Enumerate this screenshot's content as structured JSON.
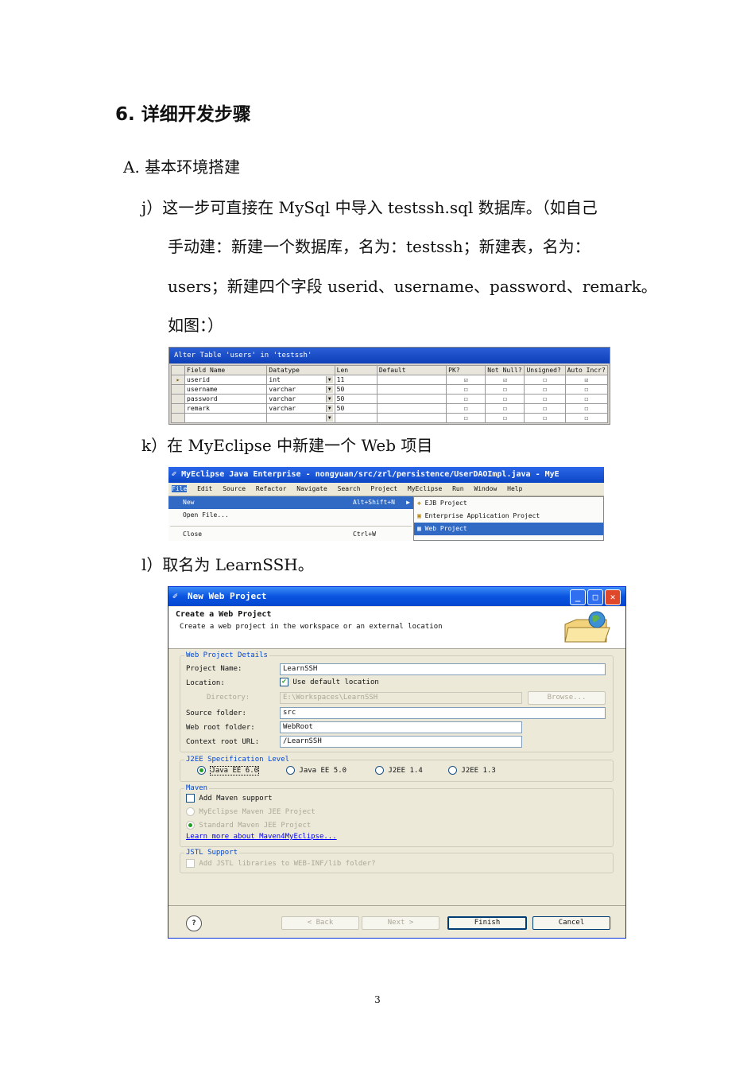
{
  "heading": "6. 详细开发步骤",
  "section_a": "A. 基本环境搭建",
  "step_j": {
    "line1": "j）这一步可直接在 MySql 中导入 testssh.sql 数据库。（如自己",
    "line2": "手动建：新建一个数据库，名为：testssh；新建表，名为：",
    "line3": "users；新建四个字段 userid、username、password、remark。",
    "line4": "如图：）"
  },
  "mysql_shot": {
    "title": "Alter Table 'users' in 'testssh'",
    "columns": [
      "Field Name",
      "Datatype",
      "Len",
      "Default",
      "PK?",
      "Not Null?",
      "Unsigned?",
      "Auto Incr?"
    ],
    "rows": [
      {
        "name": "userid",
        "type": "int",
        "len": "11",
        "pk": "☑",
        "nn": "☑",
        "un": "☐",
        "ai": "☑"
      },
      {
        "name": "username",
        "type": "varchar",
        "len": "50",
        "pk": "☐",
        "nn": "☐",
        "un": "☐",
        "ai": "☐"
      },
      {
        "name": "password",
        "type": "varchar",
        "len": "50",
        "pk": "☐",
        "nn": "☐",
        "un": "☐",
        "ai": "☐"
      },
      {
        "name": "remark",
        "type": "varchar",
        "len": "50",
        "pk": "☐",
        "nn": "☐",
        "un": "☐",
        "ai": "☐"
      },
      {
        "name": "",
        "type": "",
        "len": "",
        "pk": "☐",
        "nn": "☐",
        "un": "☐",
        "ai": "☐"
      }
    ]
  },
  "step_k": "k）在 MyEclipse 中新建一个 Web 项目",
  "eclipse_shot": {
    "title": "MyEclipse Java Enterprise - nongyuan/src/zrl/persistence/UserDAOImpl.java - MyE",
    "menubar": [
      "File",
      "Edit",
      "Source",
      "Refactor",
      "Navigate",
      "Search",
      "Project",
      "MyEclipse",
      "Run",
      "Window",
      "Help"
    ],
    "file_menu": [
      {
        "label": "New",
        "accel": "Alt+Shift+N"
      },
      {
        "label": "Open File...",
        "accel": ""
      },
      {
        "label": "Close",
        "accel": "Ctrl+W"
      }
    ],
    "submenu": [
      "EJB Project",
      "Enterprise Application Project",
      "Web Project"
    ]
  },
  "step_l": "l）取名为 LearnSSH。",
  "dialog": {
    "title": "New Web Project",
    "header_title": "Create a Web Project",
    "header_desc": "Create a web project in the workspace or an external location",
    "details_group": "Web Project Details",
    "project_name_label": "Project Name:",
    "project_name_value": "LearnSSH",
    "location_label": "Location:",
    "use_default_label": "Use default location",
    "directory_label": "Directory:",
    "directory_value": "E:\\Workspaces\\LearnSSH",
    "browse_label": "Browse...",
    "source_folder_label": "Source folder:",
    "source_folder_value": "src",
    "web_root_label": "Web root folder:",
    "web_root_value": "WebRoot",
    "context_root_label": "Context root URL:",
    "context_root_value": "/LearnSSH",
    "j2ee_group": "J2EE Specification Level",
    "j2ee_options": [
      "Java EE 6.0",
      "Java EE 5.0",
      "J2EE 1.4",
      "J2EE 1.3"
    ],
    "maven_group": "Maven",
    "add_maven_label": "Add Maven support",
    "maven_opt1": "MyEclipse Maven JEE Project",
    "maven_opt2": "Standard Maven JEE Project",
    "maven_link": "Learn more about Maven4MyEclipse...",
    "jstl_group": "JSTL Support",
    "jstl_label": "Add JSTL libraries to WEB-INF/lib folder?",
    "help_label": "?",
    "back_label": "< Back",
    "next_label": "Next >",
    "finish_label": "Finish",
    "cancel_label": "Cancel"
  },
  "page_number": "3"
}
